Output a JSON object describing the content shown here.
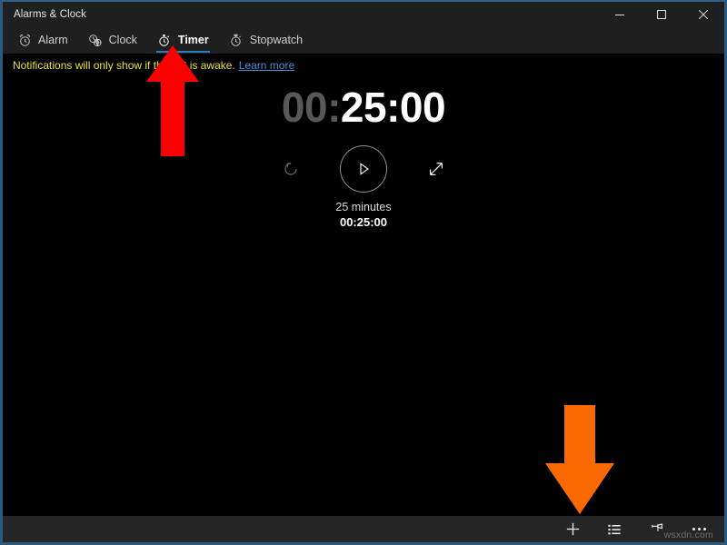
{
  "window": {
    "title": "Alarms & Clock",
    "accent_border": "#2b5a7e",
    "controls": [
      {
        "name": "minimize",
        "label": "─"
      },
      {
        "name": "maximize",
        "label": "□"
      },
      {
        "name": "close",
        "label": "✕"
      }
    ]
  },
  "nav": {
    "tabs": [
      {
        "label": "Alarm",
        "icon": "alarm-clock-icon",
        "active": false
      },
      {
        "label": "Clock",
        "icon": "world-clock-icon",
        "active": false
      },
      {
        "label": "Timer",
        "icon": "timer-icon",
        "active": true
      },
      {
        "label": "Stopwatch",
        "icon": "stopwatch-icon",
        "active": false
      }
    ],
    "active_indicator_color": "#2a7ec4"
  },
  "notice": {
    "text": "Notifications will only show if the PC is awake.",
    "link_label": "Learn more",
    "text_color": "#e8e42a",
    "link_color": "#4c8fd6"
  },
  "timer": {
    "display_dim": "00:",
    "display_active": "25:00",
    "dim_color": "#585858",
    "active_color": "#ffffff",
    "label": "25 minutes",
    "duration": "00:25:00",
    "reset_icon": "reset-icon",
    "play_icon": "play-icon",
    "expand_icon": "expand-icon"
  },
  "commandbar": {
    "buttons": [
      {
        "name": "add-timer-button",
        "icon": "plus-icon"
      },
      {
        "name": "edit-timers-button",
        "icon": "edit-list-icon"
      },
      {
        "name": "pin-to-start-button",
        "icon": "pin-icon"
      },
      {
        "name": "more-options-button",
        "icon": "ellipsis-icon"
      }
    ]
  },
  "annotations": {
    "red_arrow": {
      "direction": "up",
      "color": "#fb0000",
      "points_to": "Timer"
    },
    "orange_arrow": {
      "direction": "down",
      "color": "#fb6a00",
      "points_to": "add-timer-button"
    }
  },
  "watermark": {
    "text": "wsxdn.com"
  }
}
